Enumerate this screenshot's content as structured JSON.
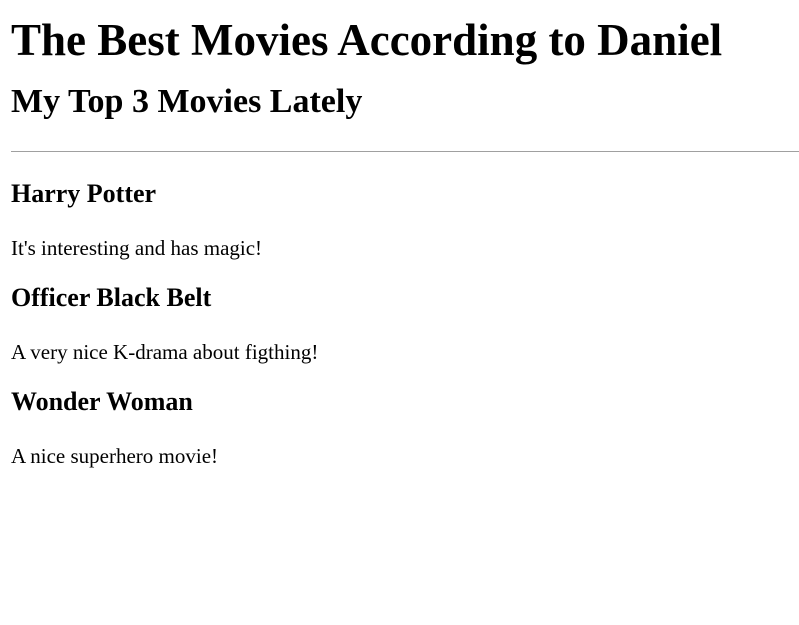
{
  "header": {
    "title": "The Best Movies According to Daniel",
    "subtitle": "My Top 3 Movies Lately"
  },
  "movies": [
    {
      "title": "Harry Potter",
      "description": "It's interesting and has magic!"
    },
    {
      "title": "Officer Black Belt",
      "description": "A very nice K-drama about figthing!"
    },
    {
      "title": "Wonder Woman",
      "description": "A nice superhero movie!"
    }
  ],
  "colors": {
    "text": "#000000",
    "background": "#ffffff",
    "divider": "#a0a0a0"
  }
}
